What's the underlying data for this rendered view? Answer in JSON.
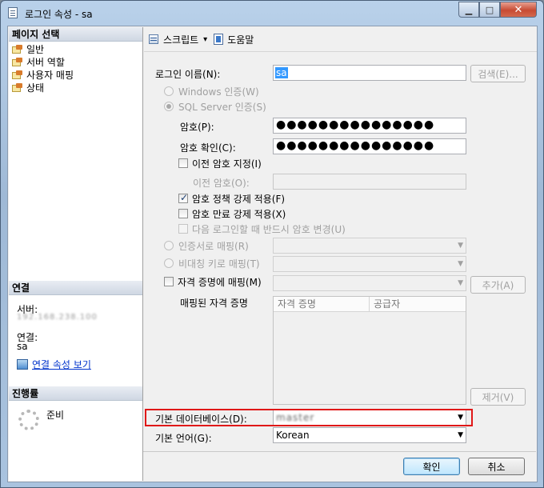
{
  "window": {
    "title": "로그인 속성 - sa",
    "min_symbol": "▁",
    "max_symbol": "□",
    "close_symbol": "✕"
  },
  "left_pane": {
    "page_select_header": "페이지 선택",
    "pages": [
      "일반",
      "서버 역할",
      "사용자 매핑",
      "상태"
    ],
    "connection_header": "연결",
    "server_label": "서버:",
    "server_value": "192.168.238.100",
    "connection_label": "연결:",
    "connection_value": "sa",
    "view_props_link": "연결 속성 보기",
    "progress_header": "진행률",
    "progress_status": "준비"
  },
  "toolbar": {
    "script_label": "스크립트",
    "script_dropdown": "▾",
    "help_label": "도움말"
  },
  "form": {
    "login_name_label": "로그인 이름(N):",
    "login_name_value": "sa",
    "search_button": "검색(E)...",
    "windows_auth_label": "Windows 인증(W)",
    "sql_auth_label": "SQL Server 인증(S)",
    "password_label": "암호(P):",
    "password_value": "●●●●●●●●●●●●●●●",
    "confirm_label": "암호 확인(C):",
    "confirm_value": "●●●●●●●●●●●●●●●",
    "specify_old_label": "이전 암호 지정(I)",
    "old_password_label": "이전 암호(O):",
    "enforce_policy_label": "암호 정책 강제 적용(F)",
    "enforce_policy_checked": true,
    "enforce_expiry_label": "암호 만료 강제 적용(X)",
    "must_change_label": "다음 로그인할 때 반드시 암호 변경(U)",
    "cert_map_label": "인증서로 매핑(R)",
    "asym_key_label": "비대칭 키로 매핑(T)",
    "cred_map_label": "자격 증명에 매핑(M)",
    "add_button": "추가(A)",
    "mapped_creds_label": "매핑된 자격 증명",
    "cred_columns": [
      "자격 증명",
      "공급자"
    ],
    "remove_button": "제거(V)",
    "default_db_label": "기본 데이터베이스(D):",
    "default_db_value": "master",
    "default_lang_label": "기본 언어(G):",
    "default_lang_value": "Korean"
  },
  "footer": {
    "ok_button": "확인",
    "cancel_button": "취소"
  }
}
